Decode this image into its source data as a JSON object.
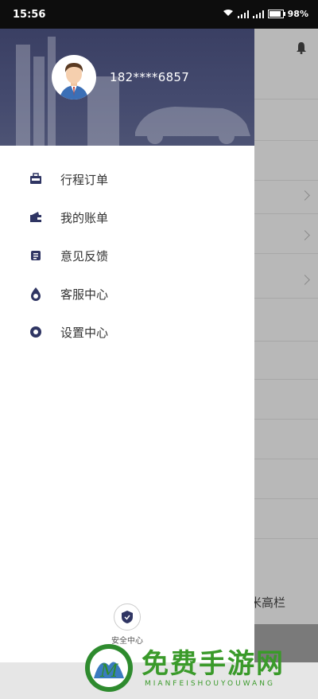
{
  "status_bar": {
    "time": "15:56",
    "battery": "98%"
  },
  "drawer": {
    "phone": "182****6857",
    "menu": [
      {
        "label": "行程订单",
        "icon": "briefcase-icon"
      },
      {
        "label": "我的账单",
        "icon": "wallet-icon"
      },
      {
        "label": "意见反馈",
        "icon": "feedback-icon"
      },
      {
        "label": "客服中心",
        "icon": "headset-icon"
      },
      {
        "label": "设置中心",
        "icon": "settings-icon"
      }
    ],
    "safety_label": "安全中心"
  },
  "background": {
    "partial_text": "米高栏"
  },
  "watermark": {
    "title": "免费手游网",
    "subtitle": "MIANFEISHOUYOUWANG"
  },
  "colors": {
    "header": "#3f4468",
    "icon": "#2f3563",
    "watermark": "#3a9a2a"
  }
}
